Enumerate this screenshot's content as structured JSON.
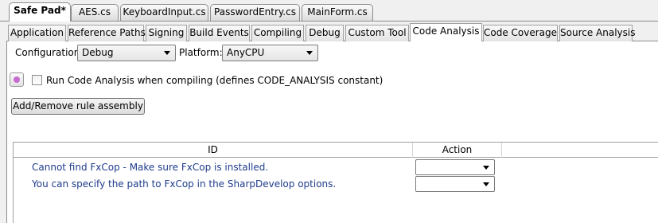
{
  "document_tabs": [
    {
      "label": "Safe Pad*",
      "active": true
    },
    {
      "label": "AES.cs",
      "active": false
    },
    {
      "label": "KeyboardInput.cs",
      "active": false
    },
    {
      "label": "PasswordEntry.cs",
      "active": false
    },
    {
      "label": "MainForm.cs",
      "active": false
    }
  ],
  "property_tabs": [
    {
      "label": "Application",
      "active": false
    },
    {
      "label": "Reference Paths",
      "active": false
    },
    {
      "label": "Signing",
      "active": false
    },
    {
      "label": "Build Events",
      "active": false
    },
    {
      "label": "Compiling",
      "active": false
    },
    {
      "label": "Debug",
      "active": false
    },
    {
      "label": "Custom Tool",
      "active": false
    },
    {
      "label": "Code Analysis",
      "active": true
    },
    {
      "label": "Code Coverage",
      "active": false
    },
    {
      "label": "Source Analysis",
      "active": false
    }
  ],
  "config": {
    "configuration_label": "Configuration:",
    "configuration_value": "Debug",
    "platform_label": "Platform:",
    "platform_value": "AnyCPU"
  },
  "code_analysis": {
    "run_checkbox_label": "Run Code Analysis when compiling (defines CODE_ANALYSIS constant)",
    "run_checked": false,
    "add_remove_button": "Add/Remove rule assembly"
  },
  "rules_grid": {
    "columns": [
      "ID",
      "Action"
    ],
    "rows": [
      {
        "id": "Cannot find FxCop - Make sure FxCop is installed.",
        "action": ""
      },
      {
        "id": "You can specify the path to FxCop in the SharpDevelop options.",
        "action": ""
      }
    ]
  }
}
